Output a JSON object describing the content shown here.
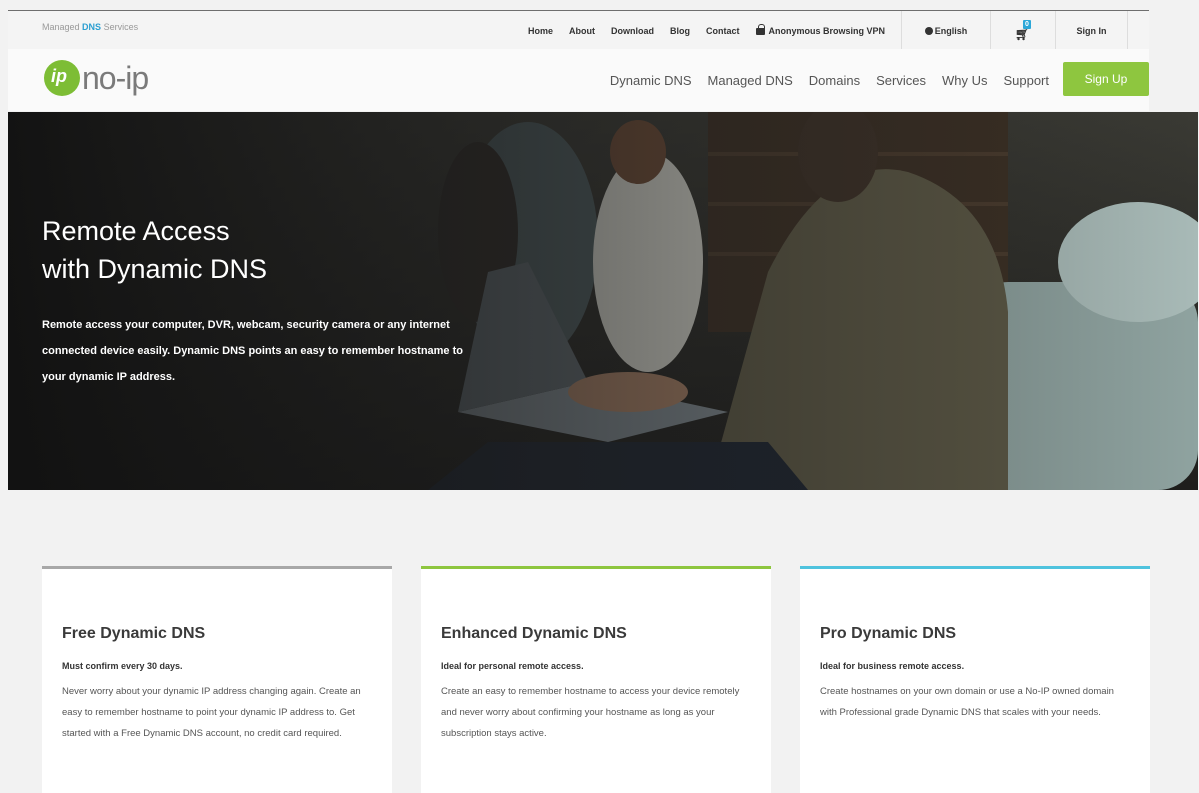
{
  "topbar": {
    "tagline_pre": "Managed",
    "tagline_dns": "DNS",
    "tagline_post": "Services",
    "links": [
      "Home",
      "About",
      "Download",
      "Blog",
      "Contact"
    ],
    "vpn_label": "Anonymous Browsing VPN",
    "language": "English",
    "cart_count": "0",
    "sign_in": "Sign In"
  },
  "nav": {
    "logo_text": "no-ip",
    "menu": [
      "Dynamic DNS",
      "Managed DNS",
      "Domains",
      "Services",
      "Why Us",
      "Support"
    ],
    "signup_label": "Sign Up"
  },
  "hero": {
    "title_line1": "Remote Access",
    "title_line2": "with Dynamic DNS",
    "description": "Remote access your computer, DVR, webcam, security camera or any internet connected device easily. Dynamic DNS points an easy to remember hostname to your dynamic IP address."
  },
  "cards": [
    {
      "title": "Free Dynamic DNS",
      "subtitle": "Must confirm every 30 days.",
      "body": "Never worry about your dynamic IP address changing again. Create an easy to remember hostname to point your dynamic IP address to. Get started with a Free Dynamic DNS account, no credit card required."
    },
    {
      "title": "Enhanced Dynamic DNS",
      "subtitle": "Ideal for personal remote access.",
      "body": "Create an easy to remember hostname to access your device remotely and never worry about confirming your hostname as long as your subscription stays active."
    },
    {
      "title": "Pro Dynamic DNS",
      "subtitle": "Ideal for business remote access.",
      "body": "Create hostnames on your own domain or use a No-IP owned domain with Professional grade Dynamic DNS that scales with your needs."
    }
  ],
  "colors": {
    "brand_green": "#8ec63f",
    "accent_blue": "#4fc3de",
    "card1_border": "#a8a8a8"
  }
}
